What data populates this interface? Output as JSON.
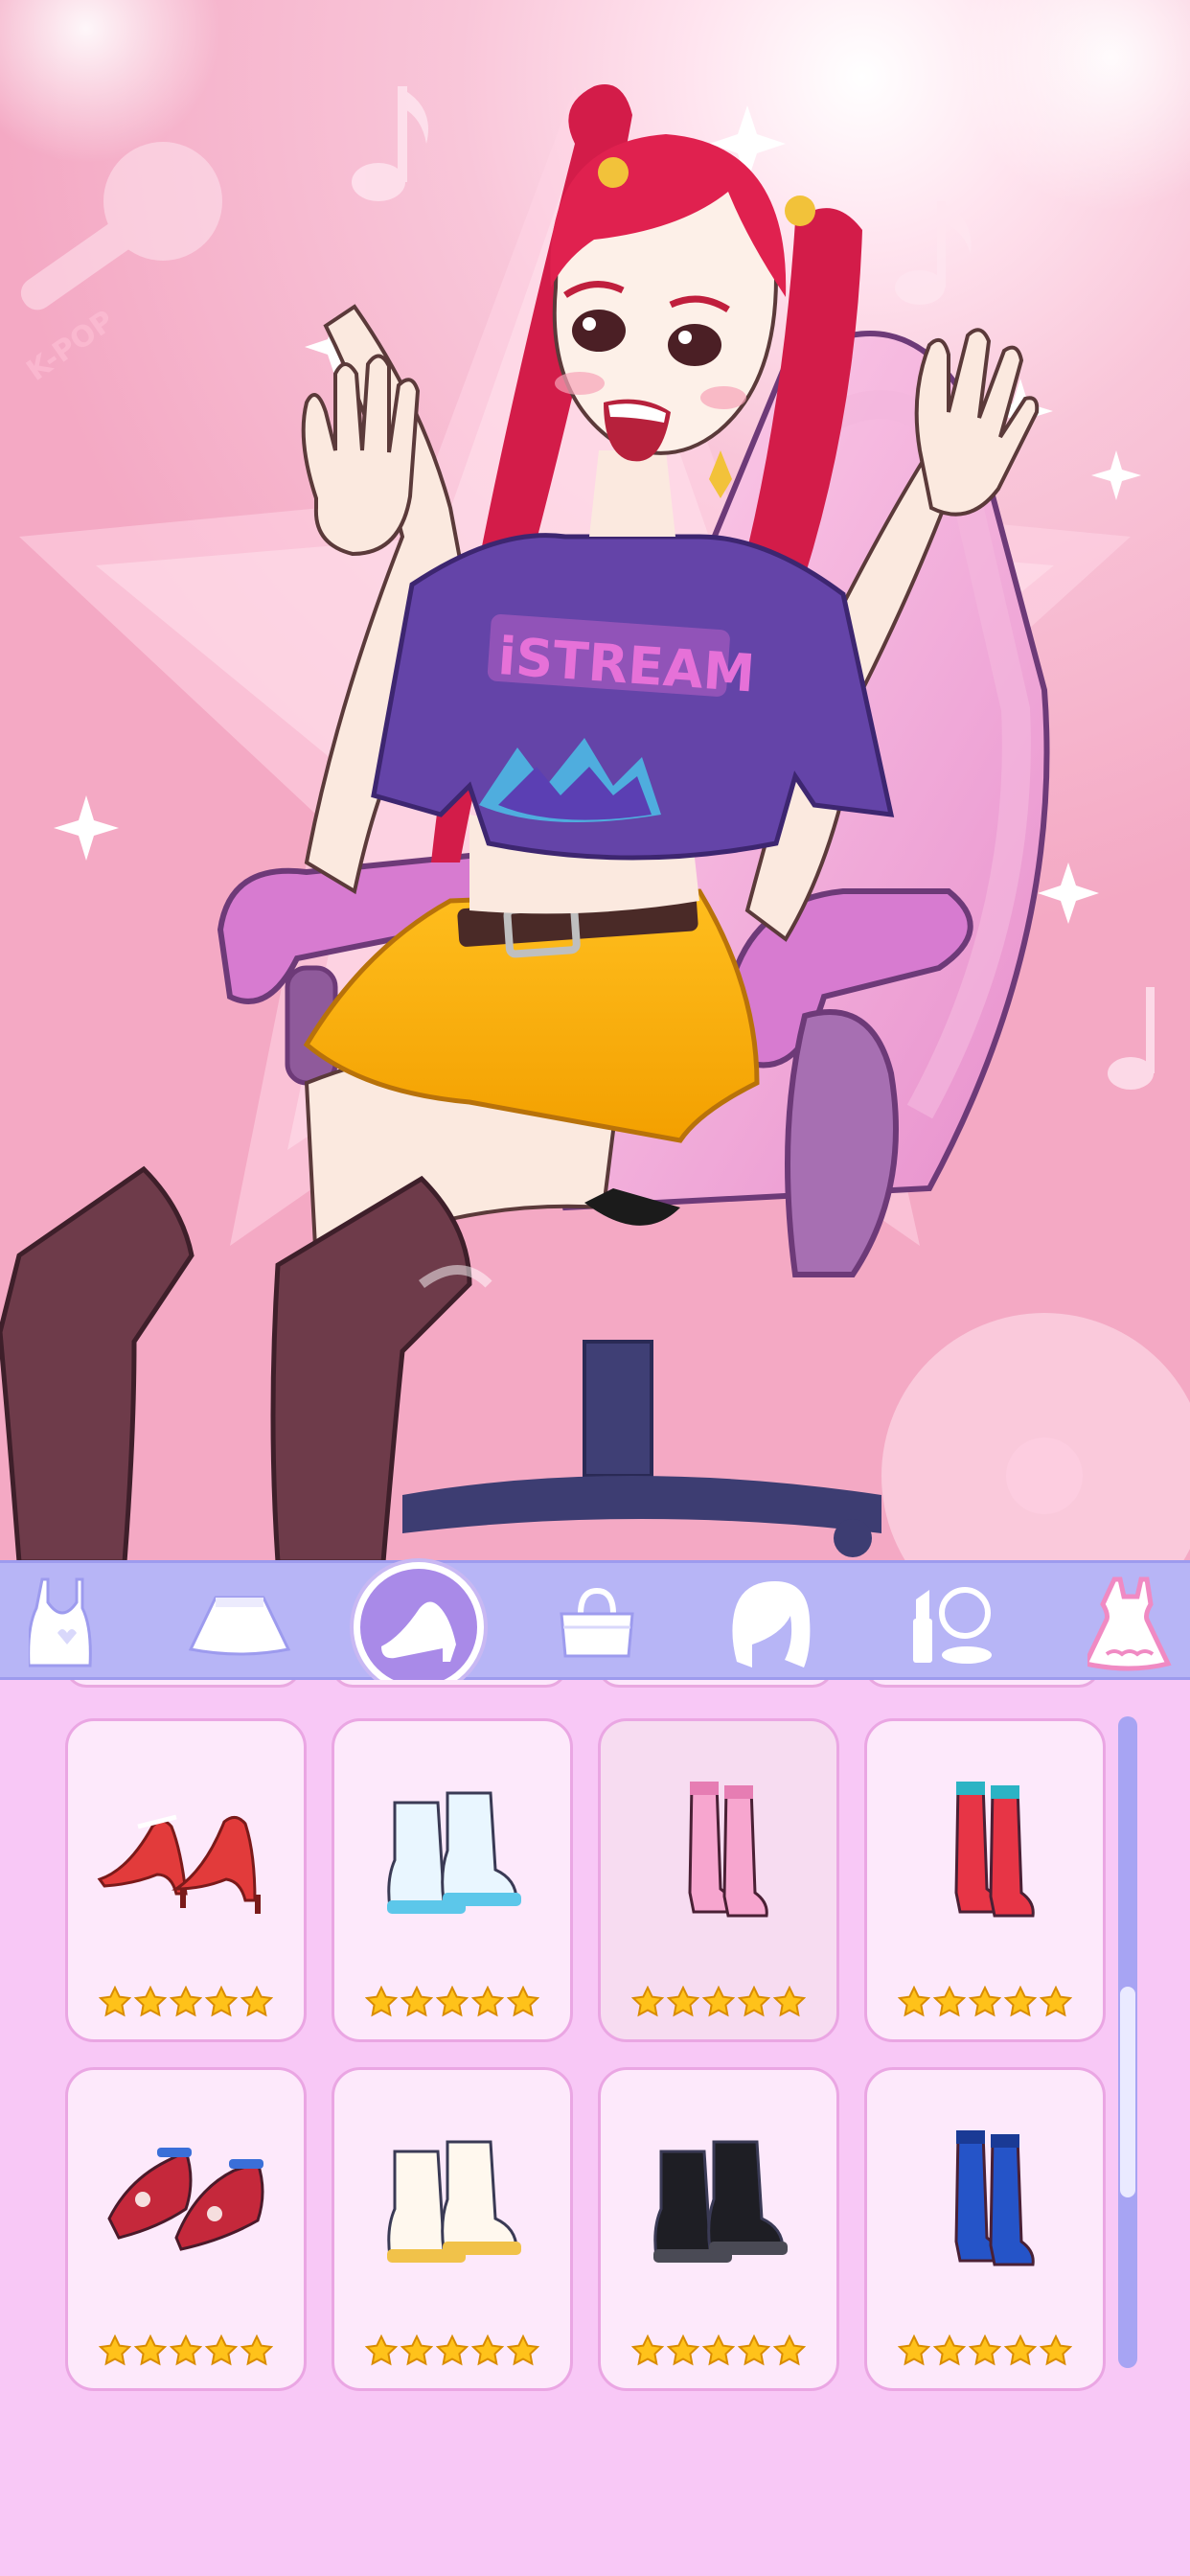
{
  "scene": {
    "shirt_text": "iSTREAM",
    "badge_text": "K-POP"
  },
  "categories": [
    {
      "name": "tops-category",
      "icon": "crop-top-icon",
      "active": false
    },
    {
      "name": "skirts-category",
      "icon": "skirt-icon",
      "active": false
    },
    {
      "name": "shoes-category",
      "icon": "high-heel-icon",
      "active": true
    },
    {
      "name": "bags-category",
      "icon": "handbag-icon",
      "active": false
    },
    {
      "name": "hair-category",
      "icon": "hair-icon",
      "active": false
    },
    {
      "name": "makeup-category",
      "icon": "lipstick-mirror-icon",
      "active": false
    },
    {
      "name": "dresses-category",
      "icon": "dress-icon",
      "active": false
    }
  ],
  "items": [
    {
      "name": "red-pumps",
      "icon": "red-pump-icon",
      "stars": 5,
      "colors": [
        "#e23b3b",
        "#ffffff"
      ]
    },
    {
      "name": "white-platform-boots",
      "icon": "ankle-boot-icon",
      "stars": 5,
      "colors": [
        "#e9f6ff",
        "#5cc7ea"
      ]
    },
    {
      "name": "pink-knee-boots",
      "icon": "knee-boot-icon",
      "stars": 5,
      "colors": [
        "#f7a6cf",
        "#e67db3"
      ],
      "selected": true
    },
    {
      "name": "red-platform-boots",
      "icon": "knee-boot-icon",
      "stars": 5,
      "colors": [
        "#e73546",
        "#2bb3c4"
      ]
    },
    {
      "name": "floral-flats",
      "icon": "flat-shoe-icon",
      "stars": 5,
      "colors": [
        "#c5283b",
        "#f6dede"
      ]
    },
    {
      "name": "white-gold-boots",
      "icon": "ankle-boot-icon",
      "stars": 5,
      "colors": [
        "#fff8ee",
        "#f1c24a"
      ]
    },
    {
      "name": "black-platform-boots",
      "icon": "ankle-boot-icon",
      "stars": 5,
      "colors": [
        "#1e1e24",
        "#4a4a55"
      ]
    },
    {
      "name": "blue-knee-boots",
      "icon": "knee-boot-icon",
      "stars": 5,
      "colors": [
        "#2554c8",
        "#1a3a95"
      ]
    }
  ],
  "colors": {
    "accent": "#a98ae8",
    "category_bar": "#b7b5f6",
    "panel": "#f8c8f6",
    "star": "#ffc21a"
  }
}
